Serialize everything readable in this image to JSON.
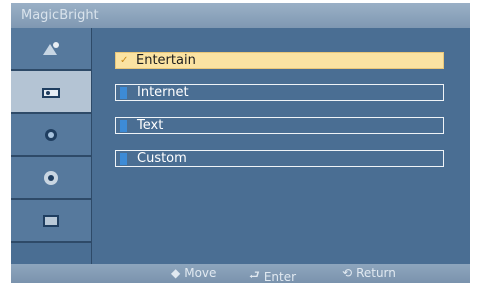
{
  "title": "MagicBright",
  "sidebar": {
    "items": [
      {
        "icon": "picture-icon",
        "active": false
      },
      {
        "icon": "magicbright-icon",
        "active": true
      },
      {
        "icon": "color-icon",
        "active": false
      },
      {
        "icon": "setup-gear-icon",
        "active": false
      },
      {
        "icon": "information-icon",
        "active": false
      }
    ]
  },
  "menu": {
    "items": [
      {
        "label": "Entertain",
        "selected": true
      },
      {
        "label": "Internet",
        "selected": false
      },
      {
        "label": "Text",
        "selected": false
      },
      {
        "label": "Custom",
        "selected": false
      }
    ],
    "check_glyph": "✓"
  },
  "footer": {
    "move": {
      "glyph": "◆",
      "label": "Move"
    },
    "enter": {
      "glyph": "⮐",
      "label": "Enter"
    },
    "return": {
      "glyph": "⟲",
      "label": "Return"
    }
  },
  "colors": {
    "background": "#4a6e93",
    "selected_bg": "#fbe3a2",
    "marker": "#3d8bd6"
  }
}
